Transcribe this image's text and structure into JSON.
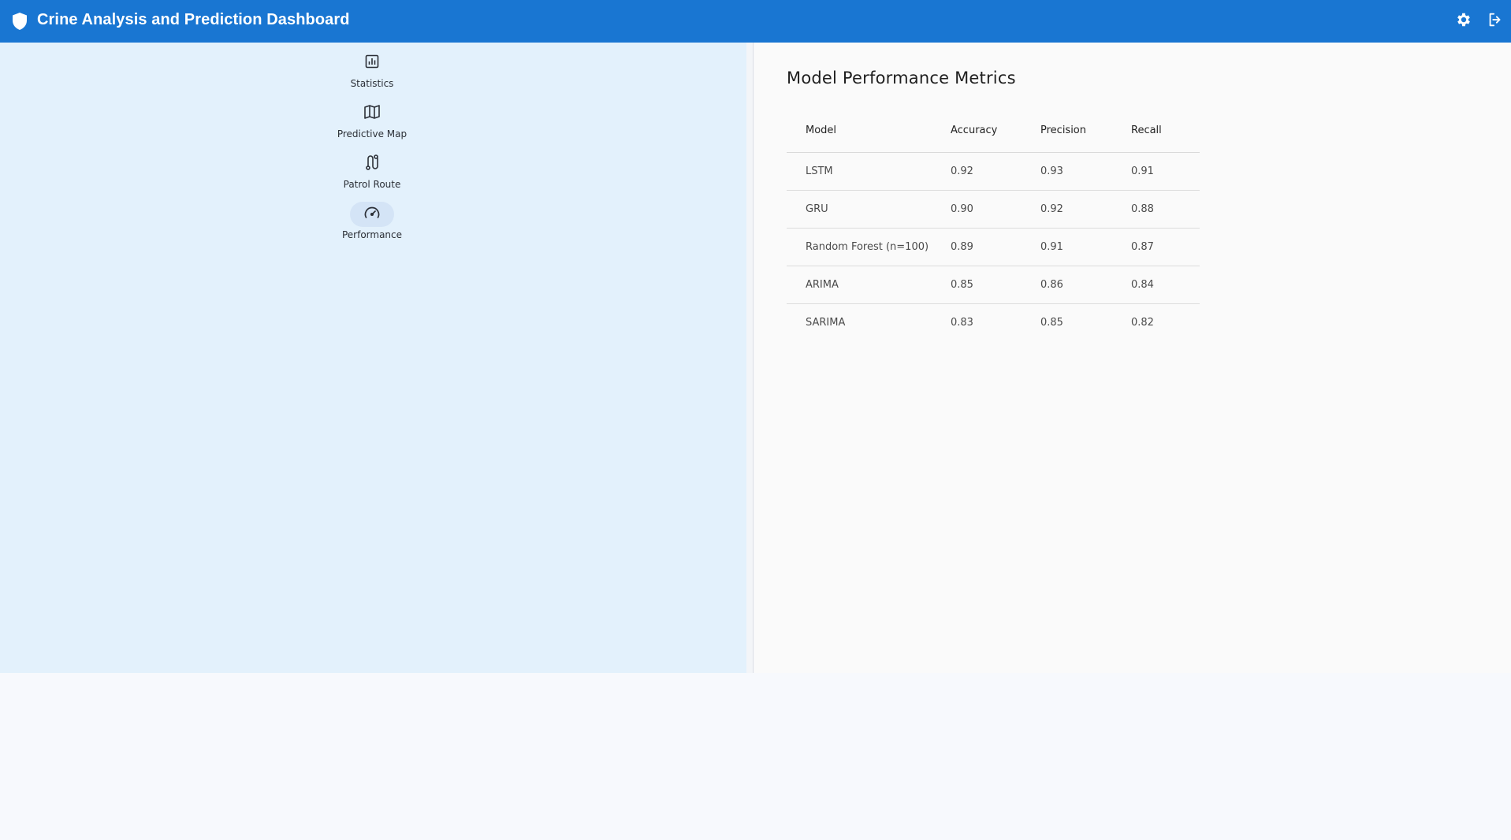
{
  "header": {
    "title": "Crine Analysis and Prediction Dashboard",
    "brand_icon": "shield-icon",
    "actions": [
      {
        "name": "settings",
        "icon": "gear-icon"
      },
      {
        "name": "logout",
        "icon": "logout-icon"
      }
    ]
  },
  "sidebar": {
    "items": [
      {
        "label": "Statistics",
        "icon": "bar-chart-icon",
        "active": false
      },
      {
        "label": "Predictive Map",
        "icon": "map-icon",
        "active": false
      },
      {
        "label": "Patrol Route",
        "icon": "route-icon",
        "active": false
      },
      {
        "label": "Performance",
        "icon": "speedometer-icon",
        "active": true
      }
    ]
  },
  "main": {
    "title": "Model Performance Metrics",
    "table": {
      "headers": [
        "Model",
        "Accuracy",
        "Precision",
        "Recall"
      ],
      "rows": [
        [
          "LSTM",
          "0.92",
          "0.93",
          "0.91"
        ],
        [
          "GRU",
          "0.90",
          "0.92",
          "0.88"
        ],
        [
          "Random Forest (n=100)",
          "0.89",
          "0.91",
          "0.87"
        ],
        [
          "ARIMA",
          "0.85",
          "0.86",
          "0.84"
        ],
        [
          "SARIMA",
          "0.83",
          "0.85",
          "0.82"
        ]
      ]
    }
  },
  "colors": {
    "appbar": "#1976d2",
    "sidebar": "#e3f1fc",
    "active_pill": "#d4e4f6"
  }
}
